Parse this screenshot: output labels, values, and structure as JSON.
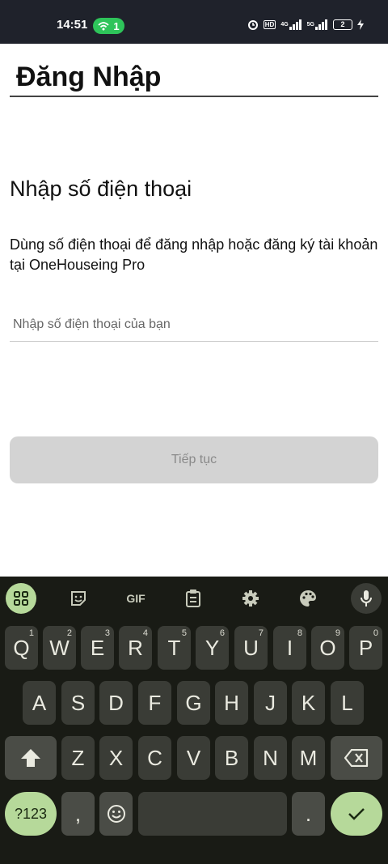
{
  "status_bar": {
    "time": "14:51",
    "hotspot_count": "1",
    "battery": "2",
    "network_labels": [
      "HD",
      "4G",
      "5G"
    ]
  },
  "page": {
    "title": "Đăng Nhập",
    "heading": "Nhập số điện thoại",
    "description": "Dùng số điện thoại để đăng nhập hoặc đăng ký tài khoản tại OneHouseing Pro",
    "phone_input": {
      "value": "",
      "placeholder": "Nhập số điện thoại của bạn"
    },
    "continue_label": "Tiếp tục"
  },
  "keyboard": {
    "toolbar": {
      "gif_label": "GIF",
      "icons": [
        "apps-grid-icon",
        "sticker-icon",
        "gif-icon",
        "clipboard-icon",
        "settings-icon",
        "palette-icon",
        "microphone-icon"
      ]
    },
    "row1": [
      {
        "label": "Q",
        "hint": "1"
      },
      {
        "label": "W",
        "hint": "2"
      },
      {
        "label": "E",
        "hint": "3"
      },
      {
        "label": "R",
        "hint": "4"
      },
      {
        "label": "T",
        "hint": "5"
      },
      {
        "label": "Y",
        "hint": "6"
      },
      {
        "label": "U",
        "hint": "7"
      },
      {
        "label": "I",
        "hint": "8"
      },
      {
        "label": "O",
        "hint": "9"
      },
      {
        "label": "P",
        "hint": "0"
      }
    ],
    "row2": [
      "A",
      "S",
      "D",
      "F",
      "G",
      "H",
      "J",
      "K",
      "L"
    ],
    "row3": [
      "Z",
      "X",
      "C",
      "V",
      "B",
      "N",
      "M"
    ],
    "symbols_label": "?123",
    "comma_label": ",",
    "period_label": ".",
    "accent_color": "#b6d99a"
  }
}
